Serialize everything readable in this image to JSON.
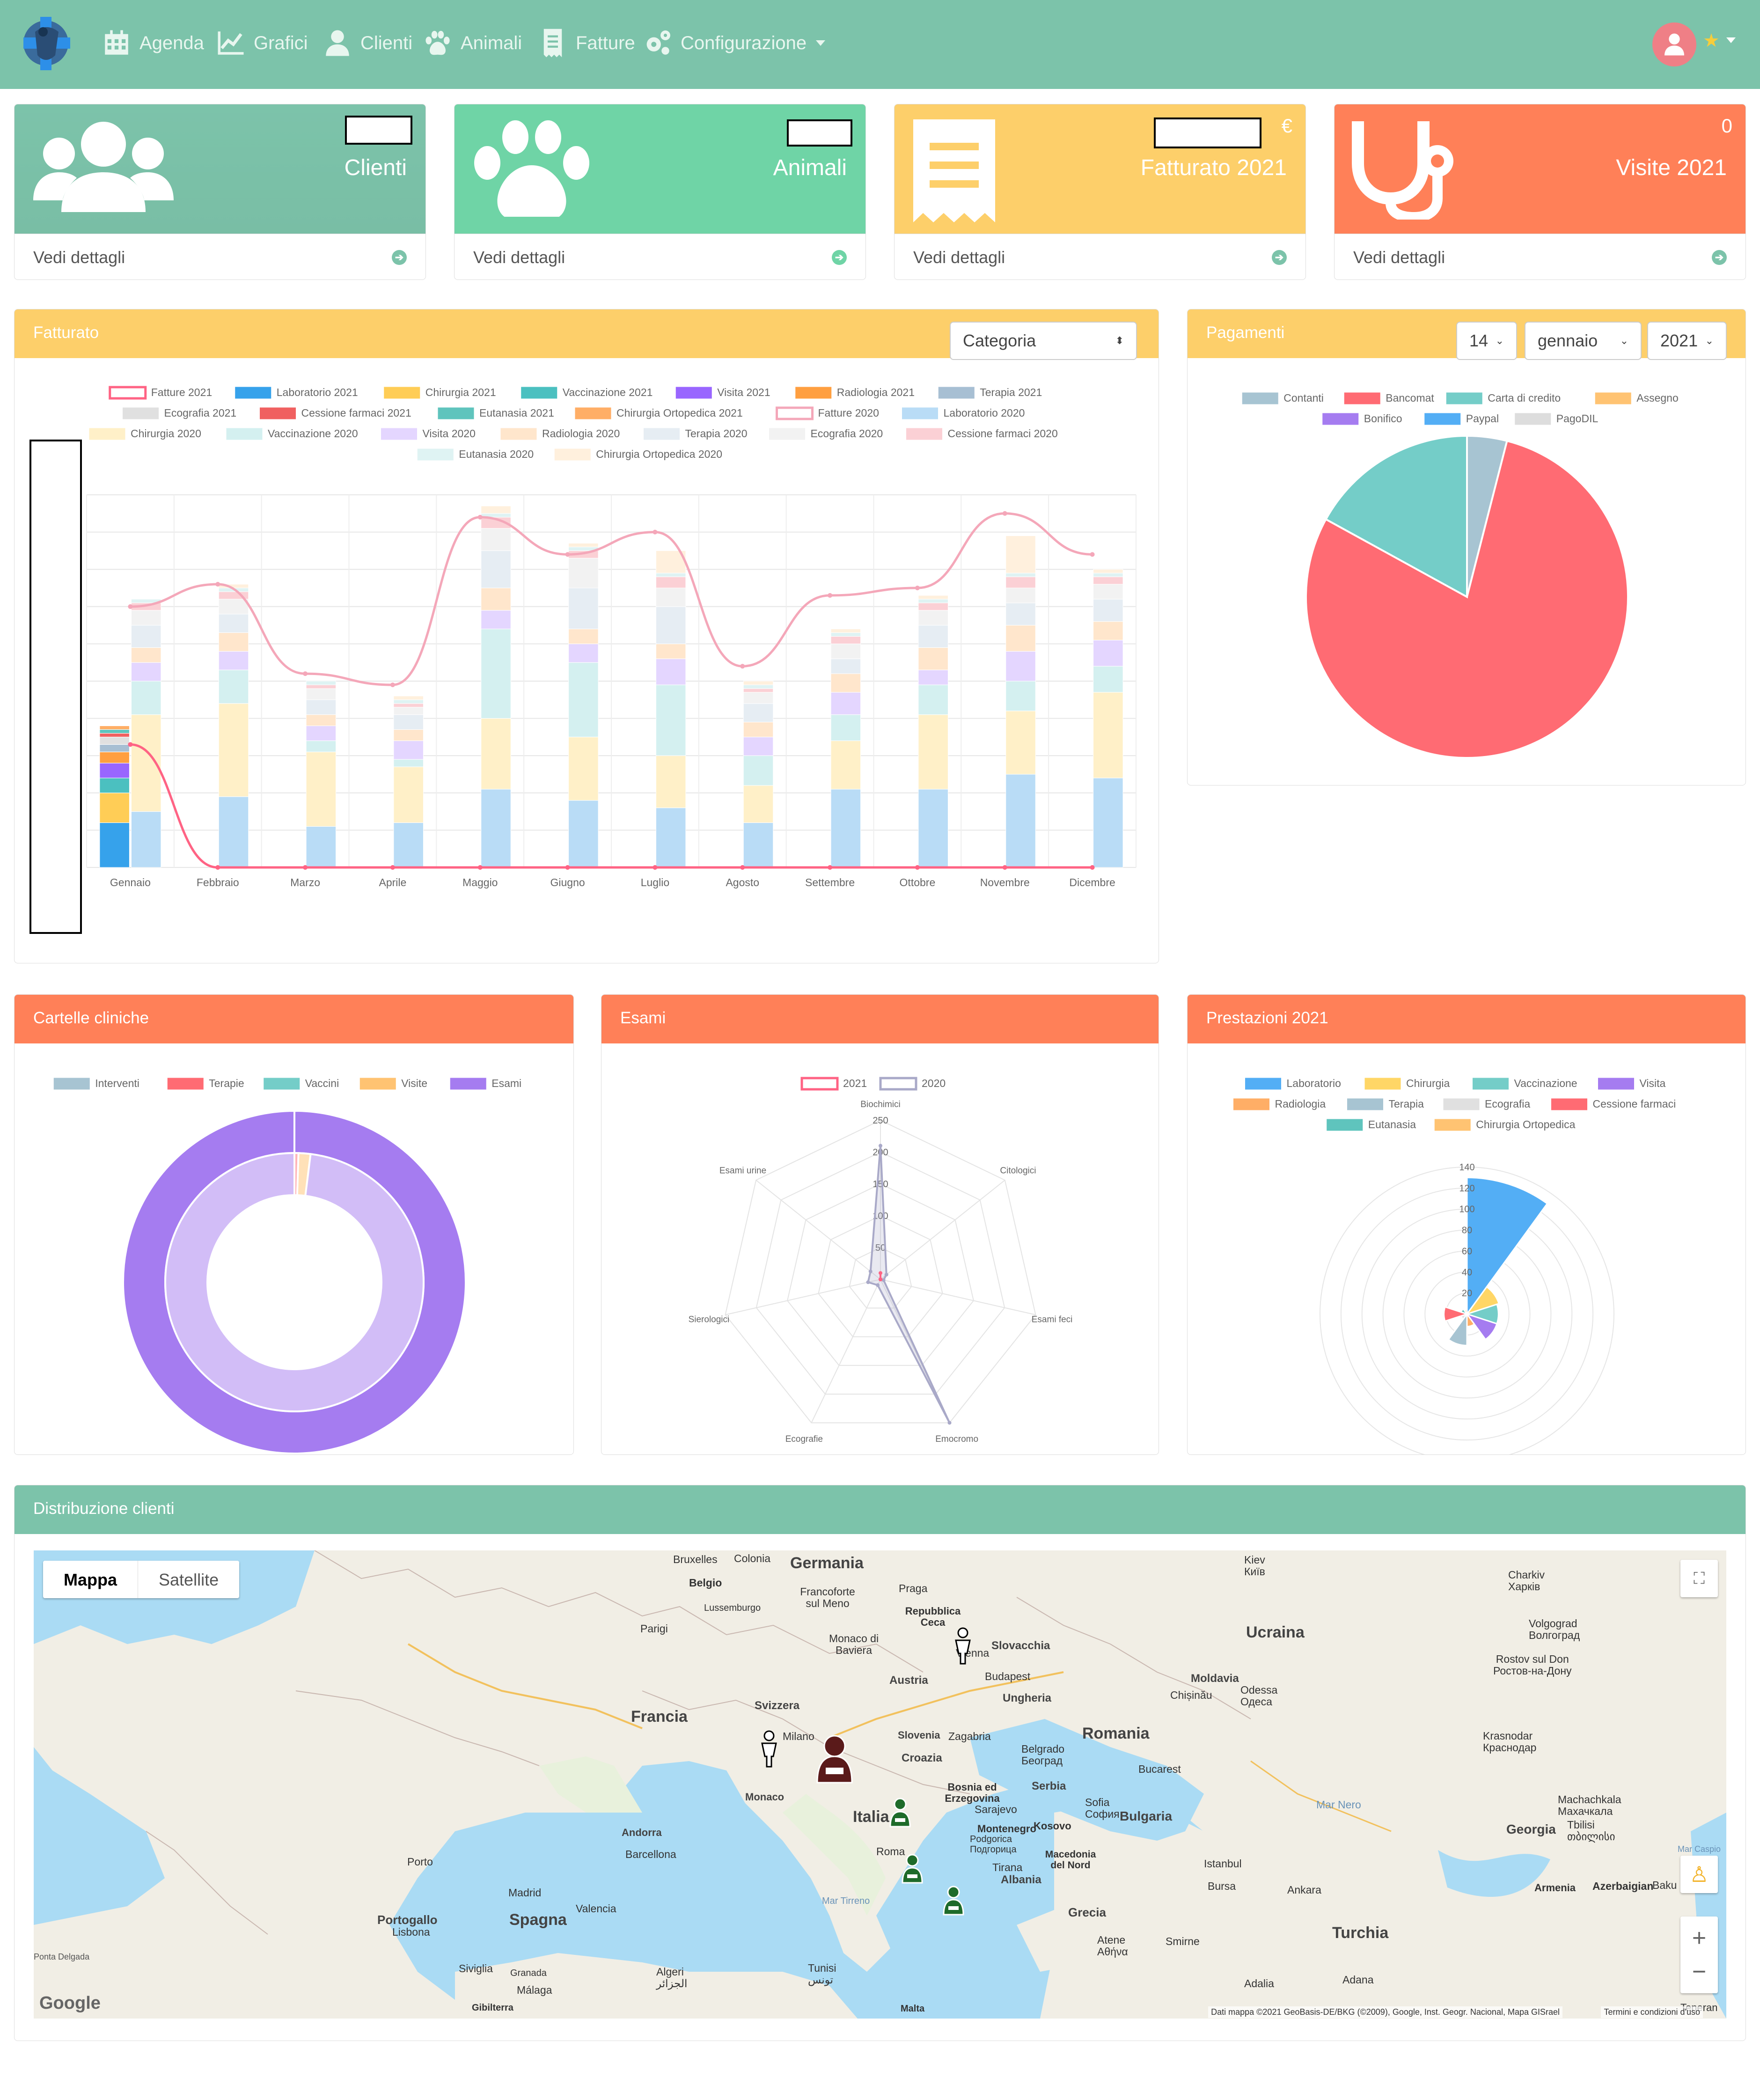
{
  "nav": {
    "items": [
      {
        "label": "Agenda",
        "icon": "calendar-icon"
      },
      {
        "label": "Grafici",
        "icon": "chart-line-icon"
      },
      {
        "label": "Clienti",
        "icon": "user-icon"
      },
      {
        "label": "Animali",
        "icon": "paw-icon"
      },
      {
        "label": "Fatture",
        "icon": "receipt-icon"
      },
      {
        "label": "Configurazione",
        "icon": "cogs-icon"
      }
    ]
  },
  "cards": [
    {
      "label": "Clienti",
      "value": "",
      "footer": "Vedi dettagli",
      "color": "#7cc3aa"
    },
    {
      "label": "Animali",
      "value": "",
      "footer": "Vedi dettagli",
      "color": "#6fd4a6"
    },
    {
      "label": "Fatturato 2021",
      "value": "€",
      "footer": "Vedi dettagli",
      "color": "#fdcf6a"
    },
    {
      "label": "Visite 2021",
      "value": "0",
      "footer": "Vedi dettagli",
      "color": "#ff8058"
    }
  ],
  "fatturato": {
    "title": "Fatturato",
    "select": "Categoria"
  },
  "pagamenti": {
    "title": "Pagamenti",
    "day": "14",
    "month": "gennaio",
    "year": "2021"
  },
  "cartelle": {
    "title": "Cartelle cliniche"
  },
  "esami": {
    "title": "Esami"
  },
  "prestazioni": {
    "title": "Prestazioni 2021"
  },
  "distribuzione": {
    "title": "Distribuzione clienti"
  },
  "chart_data": [
    {
      "type": "bar",
      "categories": [
        "Gennaio",
        "Febbraio",
        "Marzo",
        "Aprile",
        "Maggio",
        "Giugno",
        "Luglio",
        "Agosto",
        "Settembre",
        "Ottobre",
        "Novembre",
        "Dicembre"
      ],
      "series": [
        {
          "name": "Fatture 2021",
          "kind": "line",
          "color": "#ff6384",
          "values": [
            33,
            0,
            0,
            0,
            0,
            0,
            0,
            0,
            0,
            0,
            0,
            0
          ]
        },
        {
          "name": "Laboratorio 2021",
          "color": "#36a2eb",
          "values": [
            12,
            0,
            0,
            0,
            0,
            0,
            0,
            0,
            0,
            0,
            0,
            0
          ]
        },
        {
          "name": "Chirurgia 2021",
          "color": "#ffcd56",
          "values": [
            8,
            0,
            0,
            0,
            0,
            0,
            0,
            0,
            0,
            0,
            0,
            0
          ]
        },
        {
          "name": "Vaccinazione 2021",
          "color": "#4bc0c0",
          "values": [
            4,
            0,
            0,
            0,
            0,
            0,
            0,
            0,
            0,
            0,
            0,
            0
          ]
        },
        {
          "name": "Visita 2021",
          "color": "#9966ff",
          "values": [
            4,
            0,
            0,
            0,
            0,
            0,
            0,
            0,
            0,
            0,
            0,
            0
          ]
        },
        {
          "name": "Radiologia 2021",
          "color": "#ff9f40",
          "values": [
            3,
            0,
            0,
            0,
            0,
            0,
            0,
            0,
            0,
            0,
            0,
            0
          ]
        },
        {
          "name": "Terapia 2021",
          "color": "#a7bfd3",
          "values": [
            2,
            0,
            0,
            0,
            0,
            0,
            0,
            0,
            0,
            0,
            0,
            0
          ]
        },
        {
          "name": "Ecografia 2021",
          "color": "#e0e0e0",
          "values": [
            2,
            0,
            0,
            0,
            0,
            0,
            0,
            0,
            0,
            0,
            0,
            0
          ]
        },
        {
          "name": "Cessione farmaci 2021",
          "color": "#f06060",
          "values": [
            1,
            0,
            0,
            0,
            0,
            0,
            0,
            0,
            0,
            0,
            0,
            0
          ]
        },
        {
          "name": "Eutanasia 2021",
          "color": "#5fc4bd",
          "values": [
            1,
            0,
            0,
            0,
            0,
            0,
            0,
            0,
            0,
            0,
            0,
            0
          ]
        },
        {
          "name": "Chirurgia Ortopedica 2021",
          "color": "#ffae66",
          "values": [
            1,
            0,
            0,
            0,
            0,
            0,
            0,
            0,
            0,
            0,
            0,
            0
          ]
        },
        {
          "name": "Fatture 2020",
          "kind": "line",
          "color": "#f4a7b9",
          "values": [
            70,
            76,
            52,
            49,
            94,
            84,
            90,
            54,
            73,
            75,
            95,
            84
          ]
        },
        {
          "name": "Laboratorio 2020",
          "color": "#b9dcf6",
          "values": [
            15,
            19,
            11,
            12,
            21,
            18,
            16,
            12,
            21,
            21,
            25,
            24
          ]
        },
        {
          "name": "Chirurgia 2020",
          "color": "#fff0c8",
          "values": [
            26,
            25,
            20,
            15,
            19,
            17,
            14,
            10,
            13,
            20,
            17,
            23
          ]
        },
        {
          "name": "Vaccinazione 2020",
          "color": "#d4f0f0",
          "values": [
            9,
            9,
            3,
            2,
            24,
            20,
            19,
            8,
            7,
            8,
            8,
            7
          ]
        },
        {
          "name": "Visita 2020",
          "color": "#e4d6ff",
          "values": [
            5,
            5,
            4,
            5,
            5,
            5,
            7,
            5,
            6,
            4,
            8,
            7
          ]
        },
        {
          "name": "Radiologia 2020",
          "color": "#ffe6cc",
          "values": [
            4,
            5,
            3,
            3,
            6,
            4,
            4,
            4,
            5,
            6,
            7,
            5
          ]
        },
        {
          "name": "Terapia 2020",
          "color": "#e6edf3",
          "values": [
            6,
            5,
            4,
            4,
            10,
            11,
            10,
            5,
            4,
            6,
            6,
            6
          ]
        },
        {
          "name": "Ecografia 2020",
          "color": "#f2f2f2",
          "values": [
            4,
            4,
            3,
            2,
            6,
            8,
            5,
            3,
            4,
            4,
            4,
            4
          ]
        },
        {
          "name": "Cessione farmaci 2020",
          "color": "#fbd0d5",
          "values": [
            2,
            2,
            1,
            1,
            3,
            2,
            3,
            1,
            2,
            2,
            3,
            2
          ]
        },
        {
          "name": "Eutanasia 2020",
          "color": "#dff3f3",
          "values": [
            1,
            1,
            1,
            1,
            1,
            1,
            1,
            1,
            1,
            1,
            1,
            1
          ]
        },
        {
          "name": "Chirurgia Ortopedica 2020",
          "color": "#fff0dd",
          "values": [
            0,
            1,
            0,
            1,
            2,
            1,
            6,
            1,
            1,
            1,
            10,
            1
          ]
        }
      ],
      "ylim": [
        0,
        100
      ],
      "grid": true,
      "legend": "top"
    },
    {
      "type": "pie",
      "labels": [
        "Contanti",
        "Bancomat",
        "Carta di credito",
        "Assegno",
        "Bonifico",
        "Paypal",
        "PagoDIL"
      ],
      "values": [
        4,
        79,
        17,
        0,
        0,
        0,
        0
      ],
      "colors": [
        "#a7c4d2",
        "#ff6b73",
        "#74cdc8",
        "#ffc372",
        "#a57cf0",
        "#53aef5",
        "#dddddd"
      ],
      "legend": "top"
    },
    {
      "type": "doughnut",
      "labels": [
        "Interventi",
        "Terapie",
        "Vaccini",
        "Visite",
        "Esami"
      ],
      "colors": [
        "#a7c4d2",
        "#ff6b73",
        "#74cdc8",
        "#ffc372",
        "#a57cf0"
      ],
      "rings": [
        {
          "values": [
            0,
            0,
            0,
            0,
            100
          ]
        },
        {
          "values": [
            0,
            0.5,
            0,
            1.5,
            98
          ]
        }
      ],
      "legend": "top"
    },
    {
      "type": "radar",
      "labels": [
        "Biochimici",
        "Citologici",
        "Esami feci",
        "Emocromo",
        "Ecografie",
        "Sierologici",
        "Esami urine"
      ],
      "series": [
        {
          "name": "2021",
          "color": "#ff6384",
          "values": [
            10,
            0,
            0,
            0,
            0,
            0,
            0
          ]
        },
        {
          "name": "2020",
          "color": "#a9a9c8",
          "values": [
            210,
            12,
            5,
            250,
            10,
            20,
            20
          ]
        }
      ],
      "ticks": [
        "50",
        "100",
        "150",
        "200",
        "250"
      ],
      "rmax": 250,
      "legend": "top"
    },
    {
      "type": "polarArea",
      "labels": [
        "Laboratorio",
        "Chirurgia",
        "Vaccinazione",
        "Visita",
        "Radiologia",
        "Terapia",
        "Ecografia",
        "Cessione farmaci",
        "Eutanasia",
        "Chirurgia Ortopedica"
      ],
      "values": [
        130,
        32,
        30,
        30,
        12,
        30,
        6,
        22,
        6,
        4
      ],
      "colors": [
        "#53aef5",
        "#ffd666",
        "#74cdc8",
        "#a57cf0",
        "#ffae66",
        "#a7c4d2",
        "#e0e0e0",
        "#ff6b73",
        "#5fc4bd",
        "#ffc372"
      ],
      "ticks": [
        "20",
        "40",
        "60",
        "80",
        "100",
        "120",
        "140"
      ],
      "rmax": 140,
      "legend": "top"
    }
  ],
  "map": {
    "types": [
      "Mappa",
      "Satellite"
    ],
    "countries": [
      "Germania",
      "Francia",
      "Italia",
      "Spagna",
      "Ucraina",
      "Romania",
      "Turchia",
      "Portogallo",
      "Bulgaria",
      "Georgia",
      "Grecia",
      "Serbia",
      "Croazia",
      "Ungheria",
      "Slovacchia",
      "Austria",
      "Svizzera",
      "Moldavia",
      "Slovenia",
      "Albania",
      "Andorra",
      "Monaco"
    ],
    "cities": [
      "Bruxelles",
      "Colonia",
      "Belgio",
      "Lussemburgo",
      "Parigi",
      "Francoforte sul Meno",
      "Praga",
      "Repubblica Ceca",
      "Monaco di Baviera",
      "Vienna",
      "Budapest",
      "Zagabria",
      "Belgrado",
      "Sarajevo",
      "Montenegro",
      "Kosovo",
      "Podgorica",
      "Macedonia del Nord",
      "Tirana",
      "Sofia",
      "Bucarest",
      "Chișinău",
      "Odessa",
      "Kiev",
      "Charkiv",
      "Volgograd",
      "Rostov sul Don",
      "Krasnodar",
      "Milano",
      "Roma",
      "Barcellona",
      "Madrid",
      "Valencia",
      "Porto",
      "Lisbona",
      "Siviglia",
      "Granada",
      "Málaga",
      "Algeri",
      "Tunisi",
      "Malta",
      "Atene",
      "Smirne",
      "Istanbul",
      "Bursa",
      "Ankara",
      "Adalia",
      "Adana",
      "Tbilisi",
      "Armenia",
      "Azerbaigian",
      "Baku",
      "Gibilterra",
      "Mar Nero",
      "Mar Tirreno",
      "Mar Caspio",
      "Bosnia ed Erzegovina"
    ],
    "cities_native": {
      "Kiev": "Київ",
      "Charkiv": "Харків",
      "Volgograd": "Волгоград",
      "Rostov sul Don": "Ростов-на-Дону",
      "Krasnodar": "Краснодар",
      "Odessa": "Одеса",
      "Belgrado": "Београд",
      "Sofia": "София",
      "Podgorica": "Подгорица",
      "Algeri": "الجزائر",
      "Tunisi": "تونس",
      "Atene": "Αθήνα",
      "Tbilisi": "თბილისი",
      "Makhachkala": "Махачкала"
    },
    "makhachkala": "Machachkala",
    "attribution": "Dati mappa ©2021 GeoBasis-DE/BKG (©2009), Google, Inst. Geogr. Nacional, Mapa GISrael",
    "terms": "Termini e condizioni d'uso",
    "google": "Google",
    "teneran": "Teneran",
    "cortadelgada": "Ponta Delgada"
  }
}
